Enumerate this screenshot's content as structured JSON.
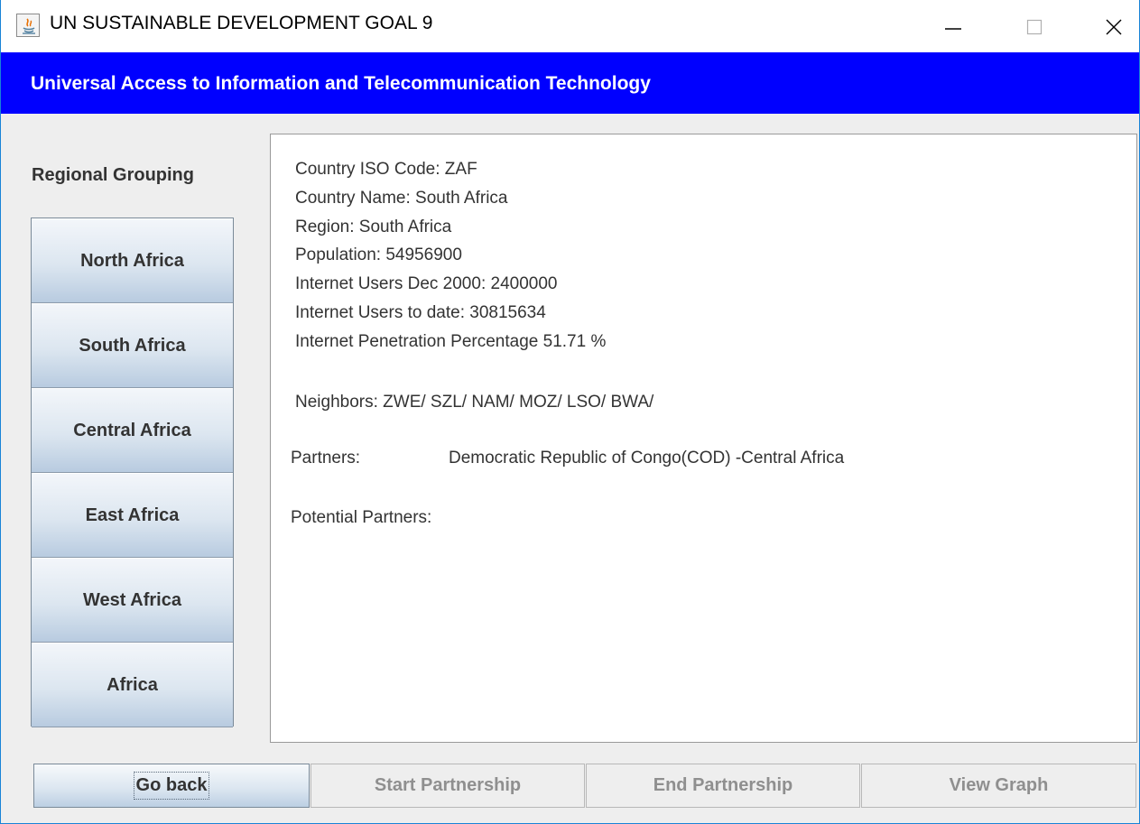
{
  "window": {
    "title": "UN SUSTAINABLE DEVELOPMENT GOAL 9"
  },
  "banner": {
    "text": "Universal Access to Information and Telecommunication Technology",
    "color": "#0000ff"
  },
  "sidebar": {
    "heading": "Regional Grouping",
    "items": [
      {
        "label": "North Africa"
      },
      {
        "label": "South Africa"
      },
      {
        "label": "Central Africa"
      },
      {
        "label": "East Africa"
      },
      {
        "label": "West Africa"
      },
      {
        "label": "Africa"
      }
    ]
  },
  "info": {
    "iso_code": "Country ISO Code: ZAF",
    "country_name": "Country Name: South Africa",
    "region": "Region: South Africa",
    "population": "Population: 54956900",
    "users_2000": "Internet Users Dec 2000: 2400000",
    "users_to_date": "Internet Users to date: 30815634",
    "penetration": "Internet Penetration Percentage 51.71 %",
    "neighbors": "Neighbors:  ZWE/ SZL/ NAM/ MOZ/ LSO/ BWA/",
    "partners_label": "Partners:",
    "partners_value": "Democratic Republic of Congo(COD) -Central Africa",
    "potential_partners_label": "Potential Partners:"
  },
  "actions": {
    "go_back": "Go back",
    "start_partnership": "Start Partnership",
    "end_partnership": "End Partnership",
    "view_graph": "View Graph"
  },
  "icons": {
    "app": "java-icon",
    "minimize": "minimize-icon",
    "maximize": "maximize-icon",
    "close": "close-icon"
  }
}
